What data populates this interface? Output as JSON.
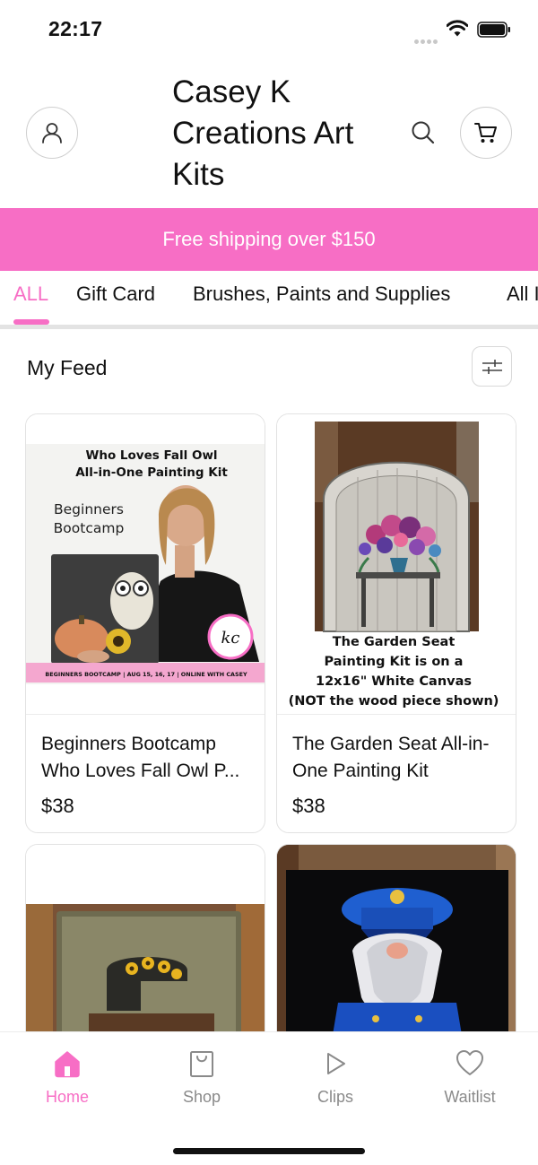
{
  "status_bar": {
    "time": "22:17"
  },
  "header": {
    "store_name": "Casey K Creations Art Kits"
  },
  "banner": {
    "text": "Free shipping over $150"
  },
  "tabs": [
    {
      "label": "ALL",
      "active": true
    },
    {
      "label": "Gift Card",
      "active": false
    },
    {
      "label": "Brushes, Paints and Supplies",
      "active": false
    },
    {
      "label": "All I",
      "active": false
    }
  ],
  "feed": {
    "title": "My Feed"
  },
  "products": [
    {
      "title": "Beginners Bootcamp Who Loves Fall Owl P...",
      "price": "$38",
      "image_text": {
        "line1": "Who Loves Fall Owl",
        "line2": "All-in-One Painting Kit",
        "tag1": "Beginners",
        "tag2": "Bootcamp",
        "footer": "BEGINNERS BOOTCAMP | AUG 15, 16, 17 | ONLINE WITH CASEY",
        "logo": "kc"
      }
    },
    {
      "title": "The Garden Seat All-in-One Painting Kit",
      "price": "$38",
      "image_text": {
        "line1": "The Garden Seat",
        "line2": "Painting Kit is on a",
        "line3": "12x16\" White Canvas",
        "line4": "(NOT the wood piece shown)"
      }
    },
    {
      "title": "",
      "price": ""
    },
    {
      "title": "",
      "price": ""
    }
  ],
  "bottom_nav": [
    {
      "label": "Home",
      "icon": "home-icon",
      "active": true
    },
    {
      "label": "Shop",
      "icon": "shopping-bag-icon",
      "active": false
    },
    {
      "label": "Clips",
      "icon": "play-icon",
      "active": false
    },
    {
      "label": "Waitlist",
      "icon": "heart-icon",
      "active": false
    }
  ],
  "colors": {
    "accent": "#f76ec5",
    "banner_text": "#ffffff",
    "inactive_nav": "#8a8a8a"
  }
}
